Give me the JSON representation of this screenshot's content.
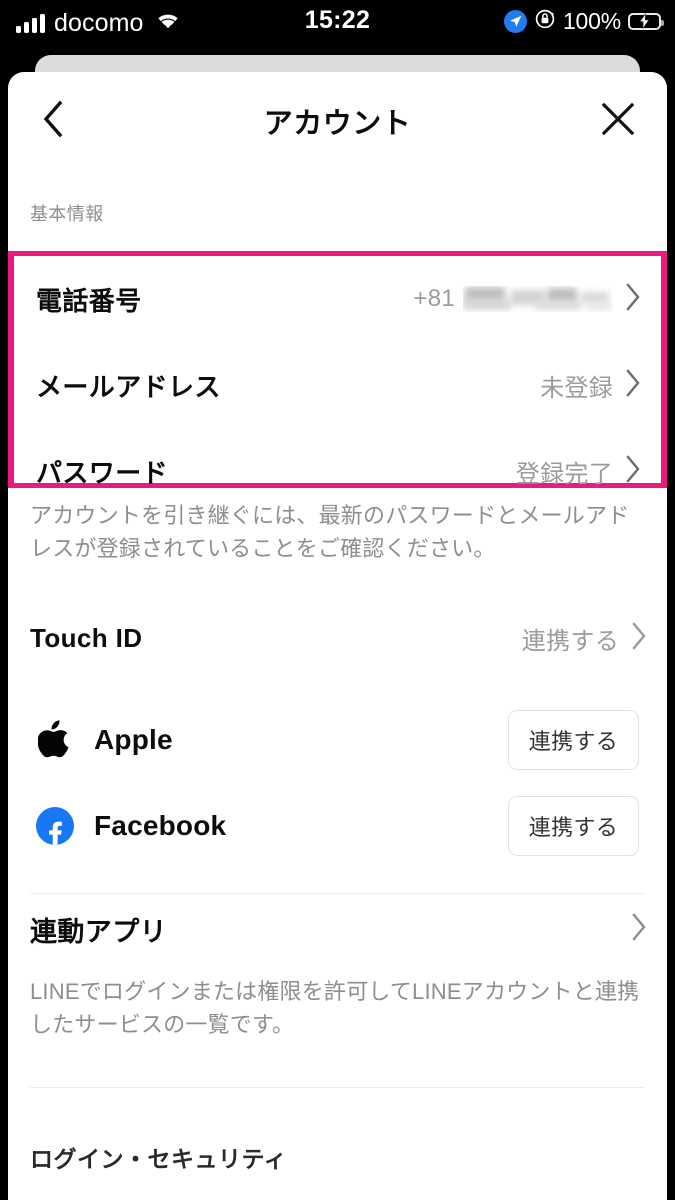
{
  "status_bar": {
    "carrier": "docomo",
    "time": "15:22",
    "battery_percent": "100%",
    "signal_icon": "cellular-bars-icon",
    "wifi_icon": "wifi-icon",
    "location_icon": "location-arrow-icon",
    "rotation_lock_icon": "rotation-lock-icon",
    "battery_icon": "battery-charging-icon"
  },
  "header": {
    "title": "アカウント",
    "back_icon": "chevron-left-icon",
    "close_icon": "close-icon"
  },
  "basic_info": {
    "section_label": "基本情報",
    "highlight_color": "#EC1A7E",
    "rows": [
      {
        "label": "電話番号",
        "value": "+81",
        "value_redacted": true
      },
      {
        "label": "メールアドレス",
        "value": "未登録",
        "value_redacted": false
      },
      {
        "label": "パスワード",
        "value": "登録完了",
        "value_redacted": false
      }
    ],
    "note": "アカウントを引き継ぐには、最新のパスワードとメールアドレスが登録されていることをご確認ください。"
  },
  "touch_id": {
    "label": "Touch ID",
    "value": "連携する"
  },
  "providers": [
    {
      "name": "Apple",
      "icon": "apple-logo-icon",
      "button_label": "連携する",
      "color": "#000000"
    },
    {
      "name": "Facebook",
      "icon": "facebook-logo-icon",
      "button_label": "連携する",
      "color": "#1877F2"
    }
  ],
  "linked_apps": {
    "title": "連動アプリ",
    "description": "LINEでログインまたは権限を許可してLINEアカウントと連携したサービスの一覧です。"
  },
  "login_security": {
    "label": "ログイン・セキュリティ"
  }
}
